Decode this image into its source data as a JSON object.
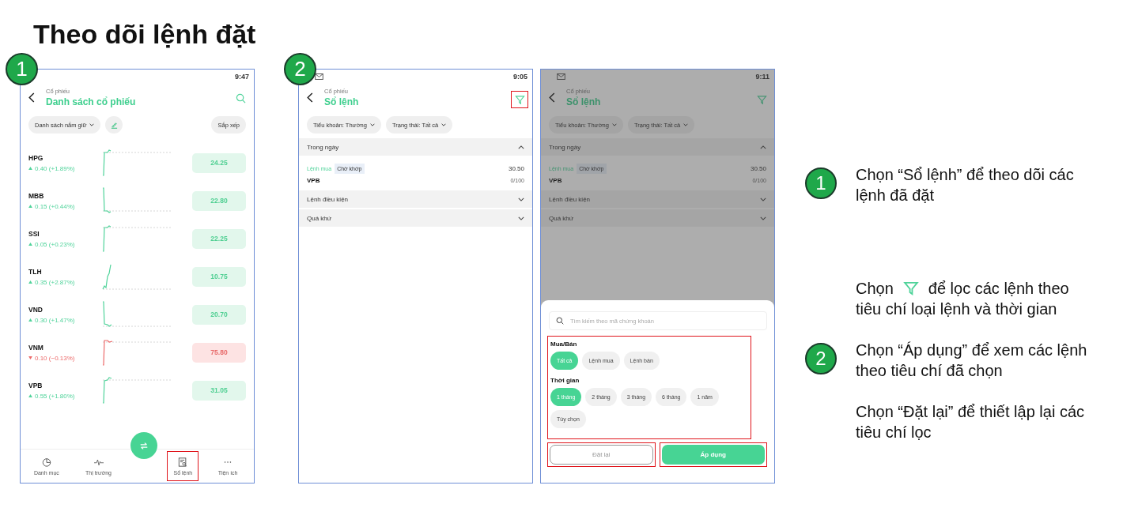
{
  "title": "Theo dõi lệnh đặt",
  "screens": [
    {
      "kind": "stock_list",
      "badge": "1",
      "time": "9:47",
      "breadcrumb": "Cổ phiếu",
      "heading": "Danh sách cổ phiếu",
      "list_filter": "Danh sách nắm giữ",
      "sort_button": "Sắp xếp",
      "stocks": [
        {
          "symbol": "HPG",
          "change": "0.40 (+1.89%)",
          "falling": false,
          "price": "24.25"
        },
        {
          "symbol": "MBB",
          "change": "0.15 (+0.44%)",
          "falling": false,
          "price": "22.80"
        },
        {
          "symbol": "SSI",
          "change": "0.05 (+0.23%)",
          "falling": false,
          "price": "22.25"
        },
        {
          "symbol": "TLH",
          "change": "0.35 (+2.87%)",
          "falling": false,
          "price": "10.75"
        },
        {
          "symbol": "VND",
          "change": "0.30 (+1.47%)",
          "falling": false,
          "price": "20.70"
        },
        {
          "symbol": "VNM",
          "change": "0.10 (−0.13%)",
          "falling": true,
          "price": "75.80"
        },
        {
          "symbol": "VPB",
          "change": "0.55 (+1.80%)",
          "falling": false,
          "price": "31.05"
        }
      ],
      "nav": [
        {
          "label": "Danh mục",
          "highlighted": false
        },
        {
          "label": "Thị trường",
          "highlighted": false
        },
        {
          "label": "Sổ lệnh",
          "highlighted": true
        },
        {
          "label": "Tiện ích",
          "highlighted": false
        }
      ]
    },
    {
      "kind": "order_book",
      "badge": "2",
      "time": "9:05",
      "breadcrumb": "Cổ phiếu",
      "heading": "Sổ lệnh",
      "filter_highlighted": true,
      "chips": [
        "Tiểu khoản: Thường",
        "Trạng thái: Tất cả"
      ],
      "sections": [
        {
          "label": "Trong ngày",
          "expanded": true,
          "orders": [
            {
              "side": "Lệnh mua",
              "status": "Chờ khớp",
              "symbol": "VPB",
              "price": "30.50",
              "filled": "0/100"
            }
          ]
        },
        {
          "label": "Lệnh điều kiện",
          "expanded": false
        },
        {
          "label": "Quá khứ",
          "expanded": false
        }
      ]
    },
    {
      "kind": "order_filter",
      "time": "9:11",
      "breadcrumb": "Cổ phiếu",
      "heading": "Sổ lệnh",
      "filter_highlighted": false,
      "chips": [
        "Tiểu khoản: Thường",
        "Trạng thái: Tất cả"
      ],
      "sections": [
        {
          "label": "Trong ngày",
          "expanded": true,
          "orders": [
            {
              "side": "Lệnh mua",
              "status": "Chờ khớp",
              "symbol": "VPB",
              "price": "30.50",
              "filled": "0/100"
            }
          ]
        },
        {
          "label": "Lệnh điều kiện",
          "expanded": false
        },
        {
          "label": "Quá khứ",
          "expanded": false
        }
      ],
      "sheet": {
        "search_placeholder": "Tìm kiếm theo mã chứng khoán",
        "options_highlighted": true,
        "groups": [
          {
            "label": "Mua/Bán",
            "options": [
              {
                "label": "Tất cả",
                "selected": true
              },
              {
                "label": "Lệnh mua",
                "selected": false
              },
              {
                "label": "Lệnh bán",
                "selected": false
              }
            ]
          },
          {
            "label": "Thời gian",
            "options": [
              {
                "label": "1 tháng",
                "selected": true
              },
              {
                "label": "2 tháng",
                "selected": false
              },
              {
                "label": "3 tháng",
                "selected": false
              },
              {
                "label": "6 tháng",
                "selected": false
              },
              {
                "label": "1 năm",
                "selected": false
              },
              {
                "label": "Tùy chọn",
                "selected": false
              }
            ]
          }
        ],
        "reset_button": {
          "label": "Đặt lại",
          "highlighted": true
        },
        "apply_button": {
          "label": "Áp dụng",
          "highlighted": true
        }
      }
    }
  ],
  "instructions": [
    {
      "kind": "step",
      "badge": "1",
      "text": "Chọn “Sổ lệnh” để theo dõi các lệnh đã đặt"
    },
    {
      "kind": "filter_note",
      "before": "Chọn",
      "after": "để lọc các lệnh theo",
      "continuation": "tiêu chí loại lệnh và thời gian"
    },
    {
      "kind": "step",
      "badge": "2",
      "text": "Chọn “Áp dụng” để xem các lệnh theo tiêu chí đã chọn"
    },
    {
      "kind": "step",
      "text": "Chọn “Đặt lại” để thiết lập lại các tiêu chí lọc"
    }
  ]
}
